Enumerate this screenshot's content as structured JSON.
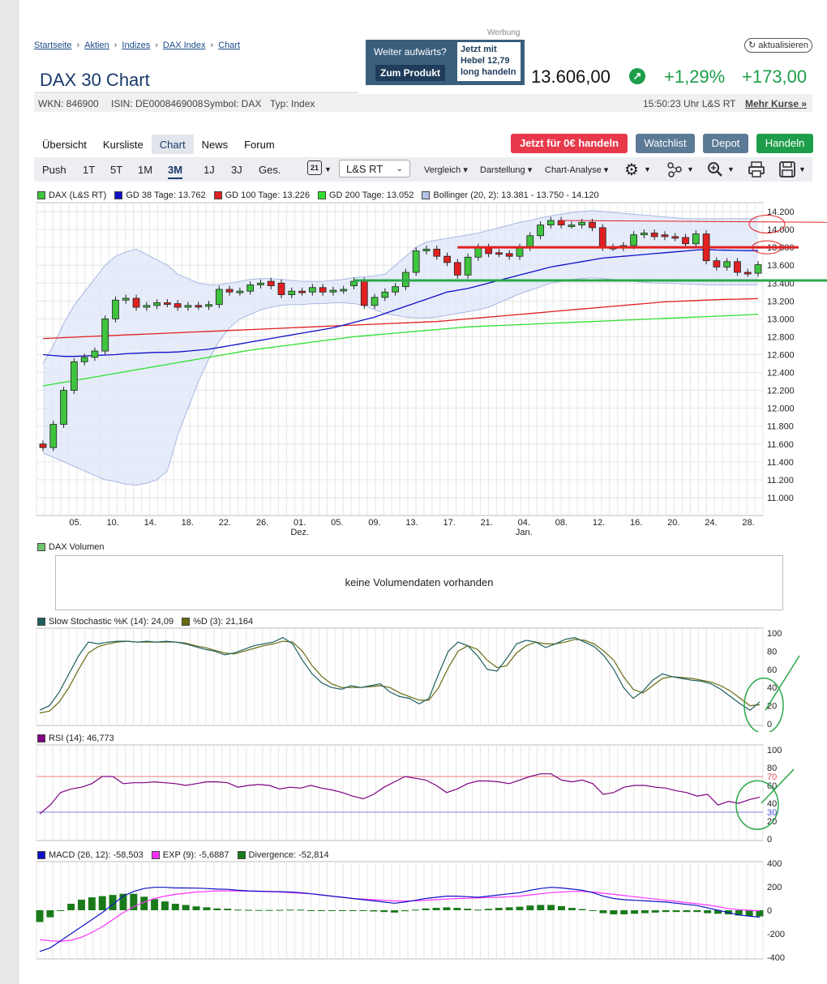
{
  "breadcrumb": [
    "Startseite",
    "Aktien",
    "Indizes",
    "DAX Index",
    "Chart"
  ],
  "ad": {
    "label": "Werbung",
    "headline": "Weiter aufwärts?",
    "button": "Zum Produkt",
    "box_line1": "Jetzt mit",
    "box_line2": "Hebel 12,79",
    "box_line3": "long handeln"
  },
  "refresh_label": "aktualisieren",
  "page_title": "DAX 30 Chart",
  "quote": {
    "price": "13.606,00",
    "change_pct": "+1,29%",
    "change_abs": "+173,00"
  },
  "info": {
    "wkn": "WKN: 846900",
    "isin": "ISIN: DE0008469008",
    "symbol": "Symbol: DAX",
    "type": "Typ: Index",
    "time": "15:50:23 Uhr L&S RT",
    "more": "Mehr Kurse »"
  },
  "tabs": [
    "Übersicht",
    "Kursliste",
    "Chart",
    "News",
    "Forum"
  ],
  "actions": {
    "trade0": "Jetzt für 0€ handeln",
    "watchlist": "Watchlist",
    "depot": "Depot",
    "handeln": "Handeln"
  },
  "ranges": [
    "Push",
    "1T",
    "5T",
    "1M",
    "3M",
    "1J",
    "3J",
    "Ges."
  ],
  "calendar_day": "21",
  "exchange": "L&S RT",
  "tools": {
    "compare": "Vergleich",
    "display": "Darstellung",
    "analysis": "Chart-Analyse"
  },
  "legend_main": [
    {
      "label": "DAX (L&S RT)",
      "color": "#3ec43e"
    },
    {
      "label": "GD 38 Tage: 13.762",
      "color": "#1010c8"
    },
    {
      "label": "GD 100 Tage: 13.226",
      "color": "#e02020"
    },
    {
      "label": "GD 200 Tage: 13.052",
      "color": "#30e030"
    },
    {
      "label": "Bollinger (20, 2): 13.381 - 13.750 - 14.120",
      "color": "#b4c4e8"
    }
  ],
  "volume": {
    "legend": "DAX Volumen",
    "empty_text": "keine Volumendaten vorhanden",
    "color": "#6fc46f"
  },
  "stoch_legend": [
    {
      "label": "Slow Stochastic %K (14): 24,09",
      "color": "#1e6060"
    },
    {
      "label": "%D (3): 21,164",
      "color": "#6a6a10"
    }
  ],
  "rsi_legend": [
    {
      "label": "RSI (14): 46,773",
      "color": "#800080"
    }
  ],
  "macd_legend": [
    {
      "label": "MACD (26, 12): -58,503",
      "color": "#1010c8"
    },
    {
      "label": "EXP (9): -5,6887",
      "color": "#ff30ff"
    },
    {
      "label": "Divergence: -52,814",
      "color": "#1a7a1a"
    }
  ],
  "chart_data": {
    "type": "candlestick",
    "x_labels": [
      "05.",
      "10.",
      "14.",
      "18.",
      "22.",
      "26.",
      "01.",
      "05.",
      "09.",
      "13.",
      "17.",
      "21.",
      "04.",
      "08.",
      "12.",
      "16.",
      "20.",
      "24.",
      "28."
    ],
    "x_sub_labels": {
      "01.": "Dez.",
      "04.": "Jan."
    },
    "y_ticks": [
      11000,
      11200,
      11400,
      11600,
      11800,
      12000,
      12200,
      12400,
      12600,
      12800,
      13000,
      13200,
      13400,
      13600,
      13800,
      14000,
      14200
    ],
    "ylim": [
      10800,
      14300
    ],
    "close": [
      11560,
      11820,
      12200,
      12520,
      12570,
      12640,
      13000,
      13210,
      13230,
      13130,
      13150,
      13180,
      13170,
      13130,
      13150,
      13140,
      13160,
      13330,
      13300,
      13310,
      13380,
      13400,
      13370,
      13270,
      13310,
      13300,
      13350,
      13300,
      13320,
      13330,
      13420,
      13150,
      13240,
      13300,
      13360,
      13520,
      13760,
      13780,
      13700,
      13630,
      13490,
      13690,
      13800,
      13730,
      13730,
      13700,
      13800,
      13930,
      14050,
      14100,
      14050,
      14050,
      14080,
      14020,
      13800,
      13800,
      13820,
      13940,
      13960,
      13920,
      13920,
      13910,
      13840,
      13950,
      13650,
      13580,
      13640,
      13520,
      13510,
      13606
    ],
    "open": [
      11600,
      11560,
      11820,
      12200,
      12520,
      12570,
      12640,
      13000,
      13210,
      13230,
      13130,
      13150,
      13180,
      13170,
      13130,
      13150,
      13140,
      13160,
      13330,
      13300,
      13310,
      13380,
      13420,
      13400,
      13270,
      13310,
      13300,
      13350,
      13300,
      13320,
      13370,
      13420,
      13150,
      13240,
      13300,
      13360,
      13520,
      13760,
      13780,
      13700,
      13630,
      13490,
      13690,
      13800,
      13740,
      13730,
      13700,
      13800,
      13930,
      14050,
      14100,
      14050,
      14050,
      14080,
      14020,
      13800,
      13800,
      13820,
      13940,
      13960,
      13940,
      13920,
      13910,
      13840,
      13950,
      13650,
      13580,
      13640,
      13520,
      13510
    ],
    "gd38": [
      12600,
      12590,
      12580,
      12580,
      12585,
      12590,
      12595,
      12600,
      12610,
      12615,
      12620,
      12625,
      12625,
      12630,
      12640,
      12650,
      12660,
      12680,
      12700,
      12720,
      12740,
      12760,
      12780,
      12800,
      12820,
      12840,
      12860,
      12880,
      12900,
      12930,
      12960,
      12990,
      13020,
      13060,
      13100,
      13140,
      13180,
      13220,
      13260,
      13300,
      13320,
      13340,
      13370,
      13400,
      13430,
      13460,
      13490,
      13520,
      13550,
      13580,
      13600,
      13620,
      13640,
      13660,
      13680,
      13690,
      13700,
      13710,
      13720,
      13730,
      13740,
      13750,
      13760,
      13770,
      13775,
      13770,
      13768,
      13765,
      13763,
      13762
    ],
    "gd100": [
      12780,
      12785,
      12790,
      12795,
      12800,
      12805,
      12810,
      12815,
      12820,
      12825,
      12830,
      12835,
      12840,
      12845,
      12850,
      12855,
      12860,
      12865,
      12870,
      12875,
      12880,
      12885,
      12890,
      12895,
      12900,
      12905,
      12910,
      12915,
      12920,
      12925,
      12930,
      12935,
      12940,
      12945,
      12950,
      12955,
      12960,
      12965,
      12970,
      12980,
      12990,
      13000,
      13010,
      13020,
      13030,
      13040,
      13050,
      13060,
      13070,
      13080,
      13090,
      13100,
      13110,
      13120,
      13130,
      13140,
      13150,
      13160,
      13170,
      13180,
      13190,
      13195,
      13200,
      13205,
      13210,
      13215,
      13218,
      13220,
      13223,
      13226
    ],
    "gd200": [
      12250,
      12270,
      12290,
      12310,
      12330,
      12350,
      12370,
      12390,
      12410,
      12430,
      12450,
      12470,
      12490,
      12510,
      12530,
      12550,
      12570,
      12590,
      12610,
      12630,
      12650,
      12665,
      12680,
      12695,
      12710,
      12725,
      12740,
      12755,
      12770,
      12785,
      12800,
      12810,
      12820,
      12830,
      12840,
      12850,
      12860,
      12870,
      12880,
      12890,
      12900,
      12910,
      12915,
      12920,
      12925,
      12930,
      12935,
      12940,
      12945,
      12950,
      12955,
      12960,
      12965,
      12970,
      12975,
      12980,
      12985,
      12990,
      12995,
      13000,
      13005,
      13010,
      13015,
      13020,
      13025,
      13030,
      13035,
      13040,
      13045,
      13052
    ],
    "boll_upper": [
      12500,
      12700,
      12950,
      13150,
      13300,
      13450,
      13600,
      13700,
      13750,
      13780,
      13720,
      13660,
      13600,
      13500,
      13450,
      13400,
      13380,
      13380,
      13400,
      13420,
      13440,
      13450,
      13450,
      13440,
      13430,
      13420,
      13420,
      13420,
      13430,
      13440,
      13460,
      13470,
      13480,
      13500,
      13600,
      13700,
      13800,
      13860,
      13880,
      13900,
      13920,
      13940,
      13960,
      13990,
      14020,
      14050,
      14080,
      14100,
      14130,
      14150,
      14170,
      14190,
      14200,
      14210,
      14200,
      14190,
      14180,
      14170,
      14160,
      14150,
      14140,
      14130,
      14120,
      14120,
      14120,
      14120,
      14120,
      14120,
      14120,
      14120
    ],
    "boll_lower": [
      11500,
      11450,
      11400,
      11350,
      11300,
      11250,
      11200,
      11180,
      11150,
      11140,
      11160,
      11200,
      11300,
      11700,
      12000,
      12300,
      12550,
      12750,
      12900,
      13000,
      13050,
      13100,
      13130,
      13150,
      13160,
      13160,
      13170,
      13170,
      13180,
      13180,
      13170,
      13150,
      13100,
      13060,
      13040,
      13020,
      13010,
      13010,
      13020,
      13040,
      13060,
      13080,
      13100,
      13130,
      13180,
      13230,
      13280,
      13320,
      13360,
      13400,
      13420,
      13440,
      13450,
      13460,
      13450,
      13440,
      13430,
      13420,
      13410,
      13400,
      13400,
      13395,
      13390,
      13385,
      13380,
      13380,
      13381,
      13381,
      13381,
      13381
    ],
    "stoch_k": [
      15,
      20,
      35,
      55,
      75,
      90,
      88,
      90,
      91,
      91,
      90,
      91,
      90,
      91,
      90,
      88,
      85,
      82,
      80,
      76,
      78,
      82,
      86,
      88,
      90,
      95,
      88,
      70,
      55,
      45,
      40,
      38,
      42,
      40,
      42,
      44,
      35,
      30,
      28,
      22,
      28,
      55,
      80,
      90,
      86,
      75,
      60,
      58,
      72,
      88,
      92,
      90,
      84,
      88,
      93,
      95,
      90,
      85,
      75,
      60,
      40,
      28,
      36,
      48,
      55,
      52,
      50,
      48,
      47,
      44,
      38,
      30,
      22,
      15,
      24
    ],
    "stoch_d": [
      12,
      14,
      24,
      40,
      60,
      78,
      85,
      88,
      90,
      91,
      90,
      90,
      90,
      90,
      90,
      89,
      86,
      84,
      81,
      78,
      77,
      80,
      83,
      86,
      88,
      91,
      90,
      80,
      64,
      52,
      44,
      40,
      40,
      40,
      41,
      42,
      40,
      34,
      30,
      26,
      26,
      40,
      62,
      80,
      86,
      82,
      70,
      62,
      64,
      78,
      86,
      90,
      88,
      88,
      90,
      93,
      92,
      88,
      80,
      70,
      52,
      38,
      34,
      42,
      50,
      52,
      51,
      50,
      48,
      46,
      42,
      36,
      28,
      20,
      21
    ],
    "rsi": [
      28,
      38,
      52,
      56,
      58,
      62,
      70,
      70,
      62,
      63,
      63,
      64,
      63,
      62,
      60,
      62,
      64,
      64,
      63,
      58,
      60,
      61,
      60,
      56,
      58,
      57,
      60,
      57,
      55,
      52,
      48,
      45,
      50,
      58,
      64,
      70,
      68,
      66,
      60,
      52,
      56,
      62,
      65,
      65,
      64,
      62,
      66,
      70,
      73,
      73,
      66,
      64,
      66,
      62,
      50,
      52,
      58,
      60,
      60,
      58,
      57,
      54,
      52,
      48,
      50,
      38,
      42,
      40,
      44,
      46.77
    ],
    "macd": [
      -350,
      -320,
      -260,
      -200,
      -140,
      -80,
      -20,
      50,
      120,
      160,
      185,
      195,
      195,
      190,
      190,
      188,
      185,
      180,
      178,
      170,
      165,
      162,
      160,
      158,
      155,
      150,
      140,
      130,
      120,
      110,
      100,
      90,
      80,
      70,
      60,
      70,
      85,
      100,
      110,
      120,
      120,
      115,
      110,
      120,
      130,
      140,
      150,
      170,
      185,
      195,
      190,
      180,
      170,
      150,
      120,
      100,
      90,
      85,
      80,
      75,
      70,
      60,
      50,
      40,
      20,
      0,
      -20,
      -40,
      -50,
      -58.5
    ],
    "macd_signal": [
      -250,
      -260,
      -265,
      -255,
      -230,
      -190,
      -140,
      -80,
      -20,
      30,
      70,
      100,
      120,
      135,
      145,
      155,
      160,
      165,
      165,
      165,
      162,
      160,
      158,
      155,
      150,
      145,
      140,
      130,
      120,
      110,
      100,
      95,
      90,
      85,
      80,
      78,
      80,
      85,
      90,
      95,
      100,
      102,
      105,
      108,
      110,
      115,
      120,
      130,
      140,
      150,
      155,
      160,
      160,
      155,
      145,
      135,
      125,
      115,
      105,
      95,
      85,
      75,
      65,
      55,
      45,
      30,
      15,
      5,
      0,
      -5.69
    ],
    "macd_div": [
      -100,
      -60,
      0,
      55,
      90,
      110,
      120,
      130,
      140,
      140,
      115,
      95,
      75,
      55,
      45,
      33,
      25,
      15,
      13,
      5,
      3,
      2,
      2,
      3,
      5,
      5,
      0,
      0,
      0,
      0,
      0,
      -5,
      -10,
      -15,
      -20,
      -8,
      5,
      15,
      20,
      25,
      20,
      13,
      5,
      12,
      20,
      25,
      30,
      40,
      45,
      45,
      35,
      20,
      10,
      -5,
      -25,
      -35,
      -35,
      -30,
      -25,
      -20,
      -15,
      -15,
      -15,
      -15,
      -25,
      -30,
      -35,
      -45,
      -50,
      -52.8
    ],
    "stoch_ticks": [
      0,
      20,
      40,
      60,
      80,
      100
    ],
    "rsi_ticks": [
      0,
      20,
      30,
      40,
      60,
      70,
      80,
      100
    ],
    "macd_ticks": [
      -400,
      -200,
      0,
      200,
      400
    ]
  }
}
